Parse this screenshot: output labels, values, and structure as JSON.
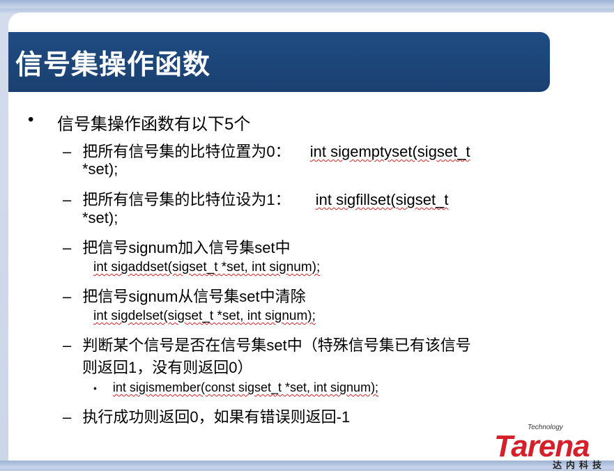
{
  "slide": {
    "title": "信号集操作函数",
    "bullet_main": "信号集操作函数有以下5个",
    "item1": {
      "dash": "–",
      "text_cn": "把所有信号集的比特位置为0：",
      "code_a": "int sigemptyset(sigset_t",
      "code_b": "*set);"
    },
    "item2": {
      "dash": "–",
      "text_cn": "把所有信号集的比特位设为1：",
      "code_a": "int sigfillset(sigset_t",
      "code_b": "*set);"
    },
    "item3": {
      "dash": "–",
      "text_cn": "把信号signum加入信号集set中",
      "code": "int sigaddset(sigset_t *set, int signum);"
    },
    "item4": {
      "dash": "–",
      "text_cn": "把信号signum从信号集set中清除",
      "code": "int sigdelset(sigset_t *set, int signum);"
    },
    "item5": {
      "dash": "–",
      "text_cn_a": "判断某个信号是否在信号集set中（特殊信号集已有该信号",
      "text_cn_b": "则返回1，没有则返回0）",
      "sub_bullet": "•",
      "code": "int sigismember(const  sigset_t *set, int signum);"
    },
    "item6": {
      "dash": "–",
      "text_cn": "执行成功则返回0，如果有错误则返回-1"
    }
  },
  "logo": {
    "word": "Tarena",
    "tagline": "Technology",
    "cn": "达内科技"
  },
  "colors": {
    "title_bar": "#1f4c83",
    "logo_red": "#d4202a",
    "squiggle": "#cc2222"
  }
}
